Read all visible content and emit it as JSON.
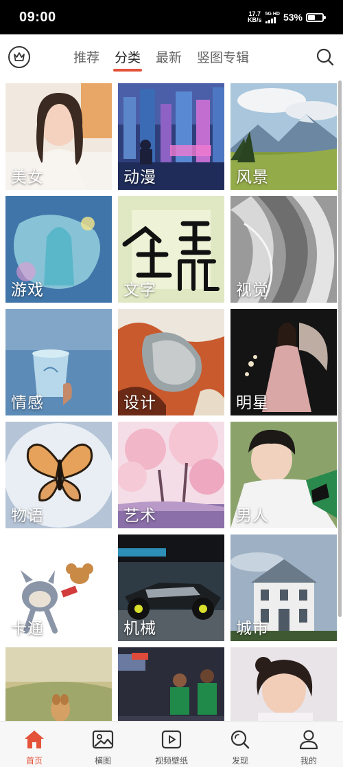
{
  "status": {
    "time": "09:00",
    "net_speed_value": "17.7",
    "net_speed_unit": "KB/s",
    "signal_label": "5G HD",
    "battery_percent": "53%",
    "battery_level": 0.53
  },
  "header": {
    "crown_icon": "crown-icon",
    "tabs": [
      {
        "label": "推荐",
        "active": false
      },
      {
        "label": "分类",
        "active": true
      },
      {
        "label": "最新",
        "active": false
      },
      {
        "label": "竖图专辑",
        "active": false
      }
    ],
    "search_icon": "search-icon",
    "accent_color": "#e4523a"
  },
  "categories": [
    {
      "label": "美女"
    },
    {
      "label": "动漫"
    },
    {
      "label": "风景"
    },
    {
      "label": "游戏"
    },
    {
      "label": "文字"
    },
    {
      "label": "视觉"
    },
    {
      "label": "情感"
    },
    {
      "label": "设计"
    },
    {
      "label": "明星"
    },
    {
      "label": "物语"
    },
    {
      "label": "艺术"
    },
    {
      "label": "男人"
    },
    {
      "label": "卡通"
    },
    {
      "label": "机械"
    },
    {
      "label": "城市"
    },
    {
      "label": ""
    },
    {
      "label": ""
    },
    {
      "label": ""
    }
  ],
  "bottom_nav": [
    {
      "label": "首页",
      "icon": "home-icon",
      "active": true
    },
    {
      "label": "横图",
      "icon": "image-icon",
      "active": false
    },
    {
      "label": "视频壁纸",
      "icon": "play-icon",
      "active": false
    },
    {
      "label": "发现",
      "icon": "discover-icon",
      "active": false
    },
    {
      "label": "我的",
      "icon": "profile-icon",
      "active": false
    }
  ]
}
